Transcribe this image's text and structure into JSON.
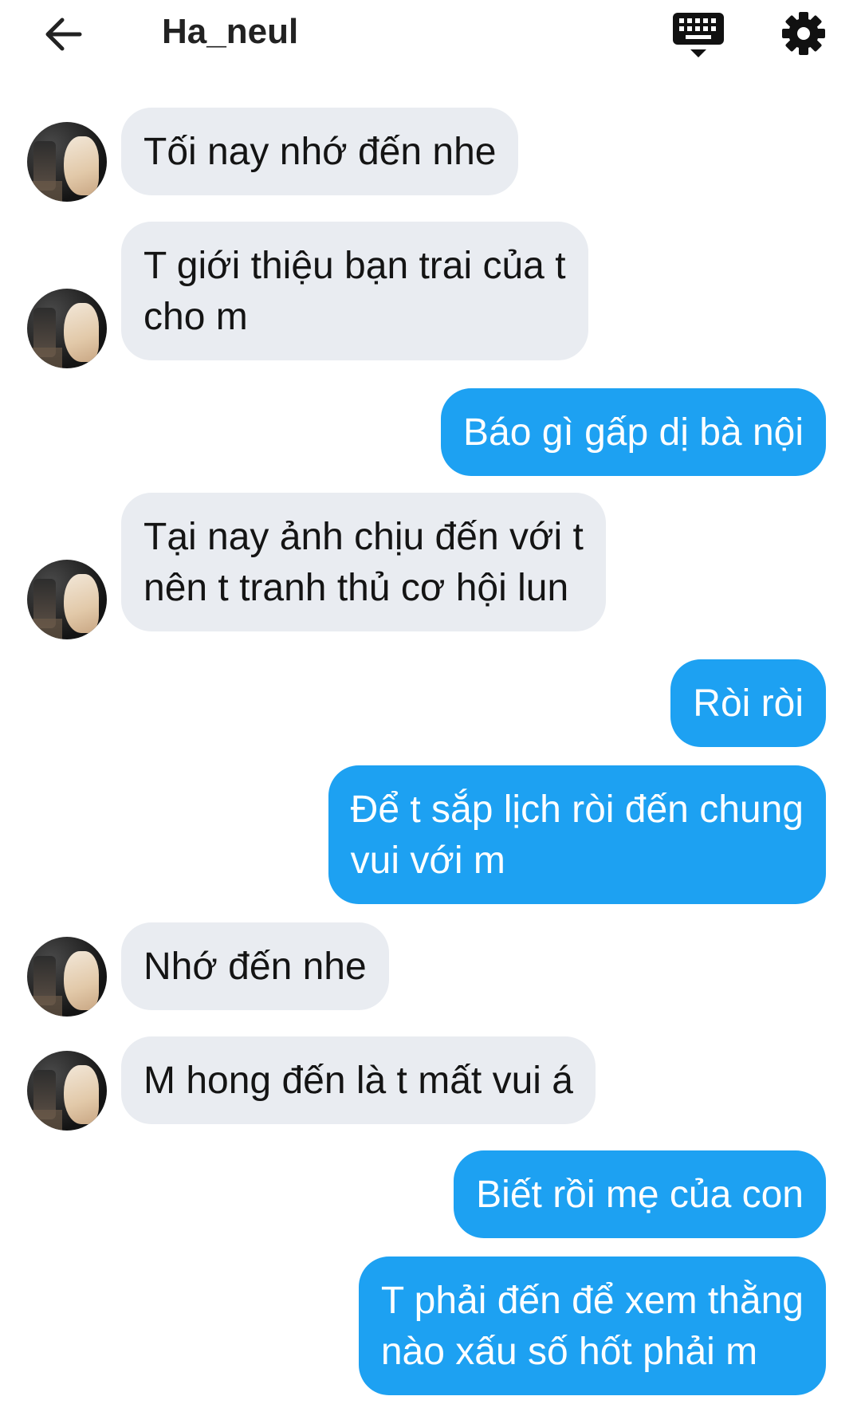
{
  "header": {
    "title": "Ha_neul",
    "back_icon": "arrow-left-icon",
    "keyboard_icon": "keyboard-hide-icon",
    "settings_icon": "gear-icon"
  },
  "colors": {
    "incoming_bubble": "#e9ecf1",
    "outgoing_bubble": "#1da1f2",
    "outgoing_text": "#ffffff",
    "incoming_text": "#141414"
  },
  "messages": [
    {
      "from": "them",
      "text": "Tối nay nhớ đến nhe"
    },
    {
      "from": "them",
      "text": "T giới thiệu bạn trai của t\ncho m"
    },
    {
      "from": "me",
      "text": "Báo gì gấp dị bà nội"
    },
    {
      "from": "them",
      "text": "Tại nay ảnh chịu đến với t\nnên t tranh thủ cơ hội lun"
    },
    {
      "from": "me",
      "text": "Ròi ròi"
    },
    {
      "from": "me",
      "text": "Để t sắp lịch ròi đến chung\nvui với m"
    },
    {
      "from": "them",
      "text": "Nhớ đến nhe"
    },
    {
      "from": "them",
      "text": "M hong đến là t mất vui á"
    },
    {
      "from": "me",
      "text": "Biết rồi mẹ của con"
    },
    {
      "from": "me",
      "text": "T phải đến để xem thằng\nnào xấu số hốt phải m"
    }
  ]
}
